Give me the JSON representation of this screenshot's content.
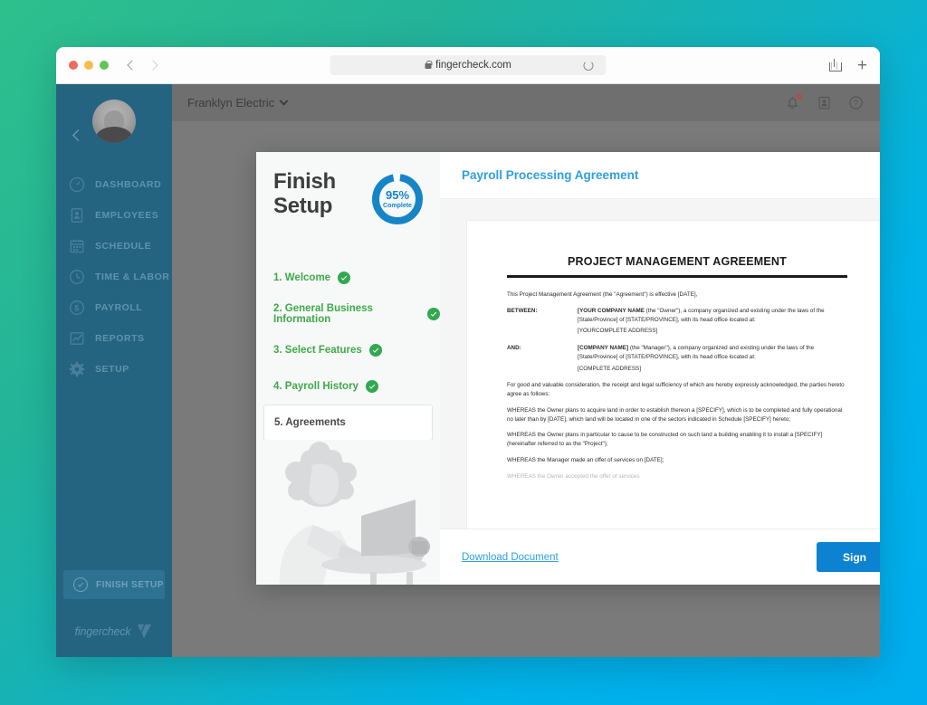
{
  "browser": {
    "url": "fingercheck.com",
    "lock_icon": "lock-icon",
    "reload_icon": "reload-icon",
    "back_icon": "chevron-left-icon",
    "forward_icon": "chevron-right-icon",
    "share_icon": "share-icon",
    "newtab_icon": "plus-icon",
    "traffic_lights": [
      "close",
      "minimize",
      "maximize"
    ]
  },
  "sidebar": {
    "avatar": "user-avatar",
    "collapse_icon": "chevron-left-icon",
    "items": [
      {
        "label": "DASHBOARD",
        "icon": "gauge-icon"
      },
      {
        "label": "EMPLOYEES",
        "icon": "address-book-icon"
      },
      {
        "label": "SCHEDULE",
        "icon": "calendar-icon"
      },
      {
        "label": "TIME & LABOR",
        "icon": "clock-icon"
      },
      {
        "label": "PAYROLL",
        "icon": "dollar-circle-icon"
      },
      {
        "label": "REPORTS",
        "icon": "chart-icon"
      },
      {
        "label": "SETUP",
        "icon": "gear-icon"
      }
    ],
    "finish_setup_button": "FINISH SETUP",
    "brand_name": "fingercheck"
  },
  "topbar": {
    "company": "Franklyn Electric",
    "caret_icon": "chevron-down-icon",
    "icons": [
      {
        "name": "bell-icon",
        "has_badge": true
      },
      {
        "name": "id-card-icon",
        "has_badge": false
      },
      {
        "name": "help-icon",
        "has_badge": false
      }
    ]
  },
  "setup": {
    "title_line1": "Finish",
    "title_line2": "Setup",
    "progress_percent": "95%",
    "progress_label": "Complete",
    "progress_value": 95,
    "accent_blue": "#1585c8",
    "steps": [
      {
        "label": "1. Welcome",
        "complete": true
      },
      {
        "label": "2. General Business Information",
        "complete": true
      },
      {
        "label": "3. Select Features",
        "complete": true
      },
      {
        "label": "4. Payroll History",
        "complete": true
      },
      {
        "label": "5. Agreements",
        "complete": false,
        "active": true
      }
    ],
    "photo": "woman-at-laptop-photo"
  },
  "document": {
    "panel_title": "Payroll Processing Agreement",
    "heading": "PROJECT MANAGEMENT AGREEMENT",
    "intro": "This Project Management Agreement (the \"Agreement\") is effective [DATE],",
    "between_label": "BETWEEN:",
    "between_party_bold": "[YOUR COMPANY NAME",
    "between_party_rest": " (the \"Owner\"), a company organized and existing under the laws of the [State/Province] of [STATE/PROVINCE], with its head office located at:",
    "between_address": "[YOURCOMPLETE ADDRESS]",
    "and_label": "AND:",
    "and_party_bold": "[COMPANY NAME]",
    "and_party_rest": " (the \"Manager\"), a company organized and existing under the laws of the [State/Province] of [STATE/PROVINCE], with its head office located at:",
    "and_address": "[COMPLETE ADDRESS]",
    "consideration": "For good and valuable consideration, the receipt and legal sufficiency of which are hereby expressly acknowledged, the parties hereto agree as follows:",
    "whereas_1": "WHEREAS the Owner plans to acquire land in order to establish thereon a [SPECIFY], which is to be completed and fully operational no later than by [DATE], which land will be located in one of the sectors indicated in Schedule [SPECIFY] hereto;",
    "whereas_2": "WHEREAS the Owner plans in particular to cause to be constructed on such land a building enabling it to install a [SPECIFY] (hereinafter referred to as the \"Project\");",
    "whereas_3": "WHEREAS the Manager made an offer of services on [DATE];",
    "whereas_4_clipped": "WHEREAS the Owner accepted the offer of services",
    "download_link": "Download Document",
    "sign_button": "Sign",
    "sign_button_color": "#0d82d0",
    "link_color": "#2f9fe0"
  }
}
